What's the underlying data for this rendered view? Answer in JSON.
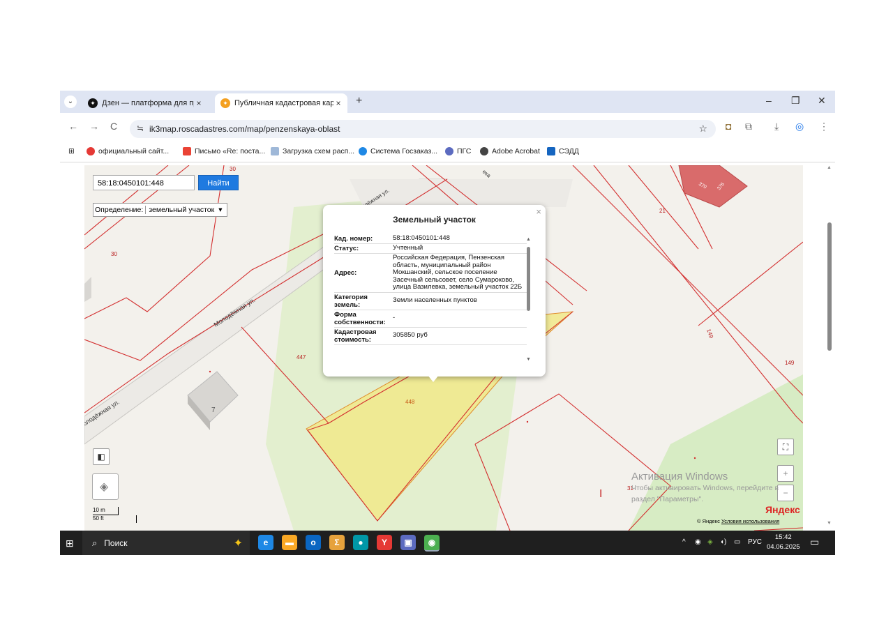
{
  "tabs": [
    {
      "title": "Дзен — платформа для просм",
      "close": "×"
    },
    {
      "title": "Публичная кадастровая карта",
      "close": "×"
    }
  ],
  "new_tab": "+",
  "window_controls": {
    "minimize": "–",
    "restore": "❐",
    "close": "✕"
  },
  "nav": {
    "back": "←",
    "forward": "→",
    "reload": "C"
  },
  "address_bar": {
    "url": "ik3map.roscadastres.com/map/penzenskaya-oblast",
    "tune_icon": "≒",
    "star": "☆"
  },
  "bookmarks": [
    {
      "label": "официальный сайт...",
      "icon_color": "#e53935"
    },
    {
      "label": "Письмо «Re: поста...",
      "icon_color": "#ea4335"
    },
    {
      "label": "Загрузка схем расп...",
      "icon_color": "#9fb8d8"
    },
    {
      "label": "Система Госзаказ...",
      "icon_color": "#1e88e5"
    },
    {
      "label": "ПГС",
      "icon_color": "#5c6bc0"
    },
    {
      "label": "Adobe Acrobat",
      "icon_color": "#444444"
    },
    {
      "label": "СЭДД",
      "icon_color": "#1565c0"
    }
  ],
  "search": {
    "value": "58:18:0450101:448",
    "button": "Найти"
  },
  "definition": {
    "label": "Определение:",
    "selected": "земельный участок"
  },
  "popup": {
    "title": "Земельный участок",
    "close": "×",
    "rows": [
      {
        "key": "Кад. номер:",
        "value": "58:18:0450101:448"
      },
      {
        "key": "Статус:",
        "value": "Учтенный"
      },
      {
        "key": "Адрес:",
        "value": "Российская Федерация, Пензенская область, муниципальный район Мокшанский, сельское поселение Засечный сельсовет, село Сумароково, улица Вазилевка, земельный участок 22Б"
      },
      {
        "key": "Категория земель:",
        "value": "Земли населенных пунктов"
      },
      {
        "key": "Форма собственности:",
        "value": "-"
      },
      {
        "key": "Кадастровая стоимость:",
        "value": "305850 руб"
      }
    ]
  },
  "map_labels": {
    "street1": "Молодёжная ул.",
    "street2": "олодёжная ул.",
    "street3": "одёжная ул.",
    "street4": "ека",
    "n30a": "30",
    "n30b": "30",
    "n447": "447",
    "n448": "448",
    "n7": "7",
    "n21": "21",
    "n149a": "149",
    "n149b": "149",
    "n31": "31",
    "n370": "370",
    "n376": "376",
    "n1": "I"
  },
  "scale": {
    "meters": "10 m",
    "feet": "50 ft"
  },
  "windows_activation": {
    "line1": "Активация Windows",
    "line2": "Чтобы активировать Windows, перейдите в",
    "line3": "раздел \"Параметры\"."
  },
  "yandex": {
    "logo": "Яндекс",
    "copyright": "© Яндекс",
    "terms": "Условия использования"
  },
  "taskbar": {
    "search_label": "Поиск",
    "language": "РУС",
    "time": "15:42",
    "date": "04.06.2025",
    "apps": [
      {
        "glyph": "e",
        "color": "#1e88e5"
      },
      {
        "glyph": "▬",
        "color": "#f9a825"
      },
      {
        "glyph": "o",
        "color": "#0a66c2"
      },
      {
        "glyph": "Σ",
        "color": "#e6a23c"
      },
      {
        "glyph": "●",
        "color": "#0097a7"
      },
      {
        "glyph": "Y",
        "color": "#e53935"
      },
      {
        "glyph": "▣",
        "color": "#5c6bc0"
      },
      {
        "glyph": "◉",
        "color": "#4caf50"
      }
    ]
  },
  "colors": {
    "accent": "#1f7ae0",
    "parcel_line": "#d32f2f",
    "selected_parcel": "#f1e98a",
    "building": "#d96b6b"
  }
}
